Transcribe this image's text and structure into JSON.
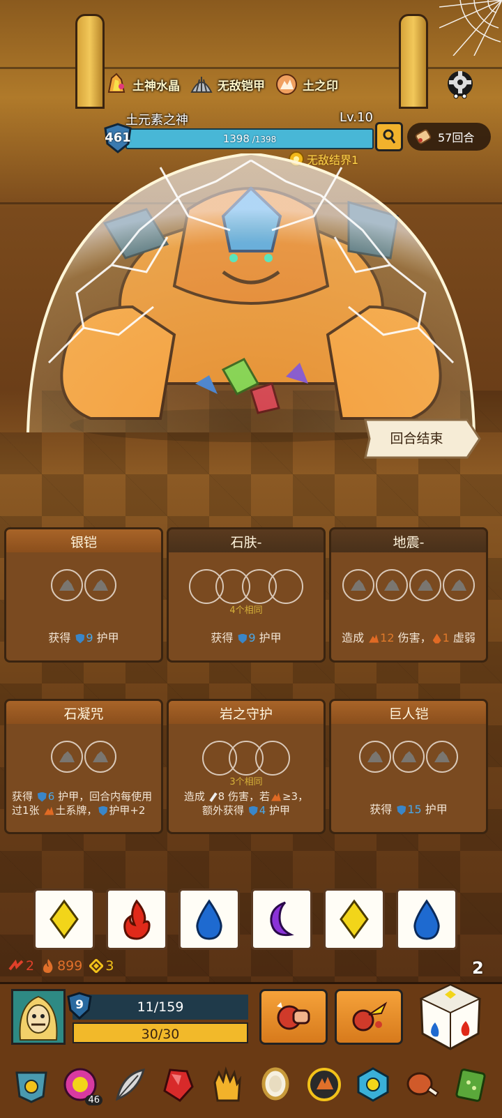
{
  "relics": [
    {
      "name": "土神水晶",
      "icon": "crystal-icon"
    },
    {
      "name": "无敌铠甲",
      "icon": "armor-shell-icon"
    },
    {
      "name": "土之印",
      "icon": "earth-seal-icon"
    }
  ],
  "boss": {
    "name": "土元素之神",
    "level": "Lv.10",
    "shield": "461",
    "hp_current": "1398",
    "hp_max": " /1398",
    "hp_fraction": 1.0,
    "effect": "无敌结界1"
  },
  "turns": "57回合",
  "end_turn_label": "回合结束",
  "cards": [
    {
      "title": "银铠",
      "style": "orange",
      "sockets": 2,
      "socket_type": "rock",
      "req": "",
      "desc": [
        "获得 ",
        "9",
        " 护甲"
      ]
    },
    {
      "title": "石肤-",
      "style": "dark",
      "sockets": 4,
      "socket_type": "empty",
      "req": "4个相同",
      "desc": [
        "获得 ",
        "9",
        " 护甲"
      ]
    },
    {
      "title": "地震-",
      "style": "dark",
      "sockets": 4,
      "socket_type": "rock",
      "req": "",
      "desc_quake": {
        "a": "造成 ",
        "dmg": "12",
        "b": " 伤害，",
        "weak": "1",
        "c": " 虚弱"
      }
    },
    {
      "title": "石凝咒",
      "style": "orange",
      "sockets": 2,
      "socket_type": "rock",
      "req": "",
      "desc_multi": {
        "a": "获得 ",
        "armor": "6",
        "b": " 护甲，回合内每使用过1张 ",
        "c": "土系牌，",
        "d": "护甲+2"
      }
    },
    {
      "title": "岩之守护",
      "style": "orange",
      "sockets": 3,
      "socket_type": "empty",
      "req": "3个相同",
      "desc_guard": {
        "a": "造成 ",
        "dmg": "8",
        "b": " 伤害，若",
        "cond": "≥3，",
        "c": "额外获得 ",
        "armor": "4",
        "d": " 护甲"
      }
    },
    {
      "title": "巨人铠",
      "style": "orange",
      "sockets": 3,
      "socket_type": "rock",
      "req": "",
      "desc": [
        "获得 ",
        "15",
        " 护甲"
      ]
    }
  ],
  "dice": [
    {
      "face": "diamond",
      "color": "#f2d51a"
    },
    {
      "face": "flame",
      "color": "#e02a1a"
    },
    {
      "face": "drop",
      "color": "#1e6ad0"
    },
    {
      "face": "moon",
      "color": "#8a32d8"
    },
    {
      "face": "diamond",
      "color": "#f2d51a"
    },
    {
      "face": "drop",
      "color": "#1e6ad0"
    }
  ],
  "resources": {
    "attack": "2",
    "attack_color": "#e0402a",
    "fire": "899",
    "fire_color": "#e0702a",
    "gem": "3",
    "gem_color": "#f2c21a"
  },
  "dice_remaining": "2",
  "player": {
    "shield": "9",
    "hp": "11/159",
    "energy": "30/30",
    "energy_fraction": 1.0
  },
  "inventory": [
    {
      "icon": "armor-relic-icon"
    },
    {
      "icon": "potion-orb-icon",
      "count": "46"
    },
    {
      "icon": "feather-icon"
    },
    {
      "icon": "red-gem-icon"
    },
    {
      "icon": "glove-icon"
    },
    {
      "icon": "mirror-icon"
    },
    {
      "icon": "earth-amulet-icon"
    },
    {
      "icon": "ice-emblem-icon"
    },
    {
      "icon": "meat-icon"
    },
    {
      "icon": "green-book-icon"
    }
  ]
}
